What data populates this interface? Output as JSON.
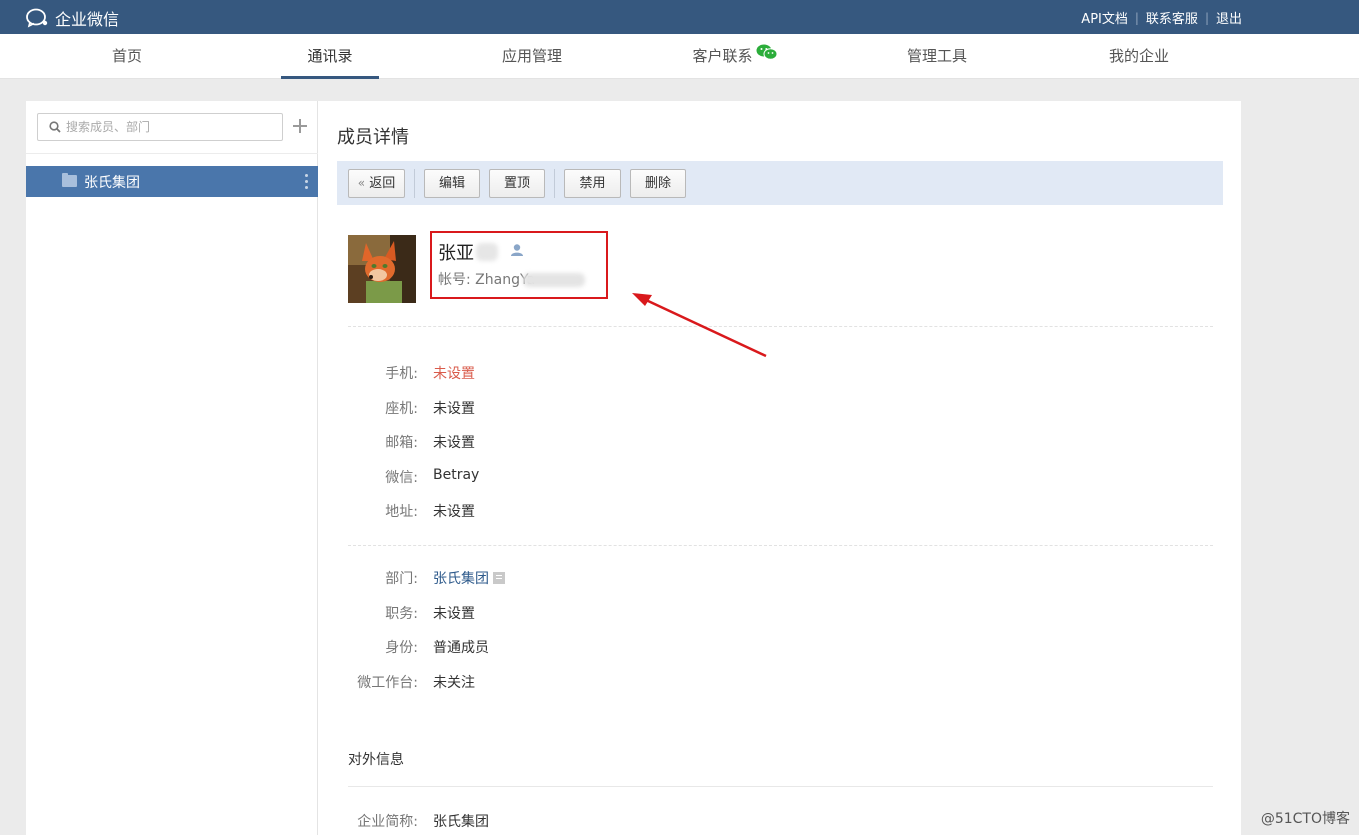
{
  "topbar": {
    "app_name": "企业微信",
    "links": [
      "API文档",
      "联系客服",
      "退出"
    ],
    "link_separator": "|",
    "bg_color": "#36587f"
  },
  "nav": {
    "items": [
      {
        "label": "首页",
        "active": false
      },
      {
        "label": "通讯录",
        "active": true
      },
      {
        "label": "应用管理",
        "active": false
      },
      {
        "label": "客户联系",
        "active": false,
        "icon": "wechat-icon"
      },
      {
        "label": "管理工具",
        "active": false
      },
      {
        "label": "我的企业",
        "active": false
      }
    ]
  },
  "sidebar": {
    "search_placeholder": "搜索成员、部门",
    "departments": [
      {
        "label": "张氏集团",
        "selected": true
      }
    ],
    "selected_color": "#4a76ab"
  },
  "detail": {
    "title": "成员详情",
    "toolbar": {
      "back_label": "返回",
      "edit_label": "编辑",
      "pin_label": "置顶",
      "disable_label": "禁用",
      "delete_label": "删除"
    },
    "member": {
      "name": "张亚",
      "account_label": "帐号:",
      "account_value": "ZhangYa"
    },
    "contact_fields": [
      {
        "key": "手机:",
        "value": "未设置"
      },
      {
        "key": "座机:",
        "value": "未设置"
      },
      {
        "key": "邮箱:",
        "value": "未设置"
      },
      {
        "key": "微信:",
        "value": "Betray"
      },
      {
        "key": "地址:",
        "value": "未设置"
      }
    ],
    "org_fields": [
      {
        "key": "部门:",
        "value": "张氏集团"
      },
      {
        "key": "职务:",
        "value": "未设置"
      },
      {
        "key": "身份:",
        "value": "普通成员"
      },
      {
        "key": "微工作台:",
        "value": "未关注"
      }
    ],
    "external_section_title": "对外信息",
    "external_fields": [
      {
        "key": "企业简称:",
        "value": "张氏集团"
      }
    ]
  },
  "watermark": "@51CTO博客",
  "colors": {
    "unset_red": "#d95b4b",
    "highlight_red": "#d9191c",
    "link_blue": "#2f5b8c",
    "toolbar_bg": "#e1e9f5"
  }
}
